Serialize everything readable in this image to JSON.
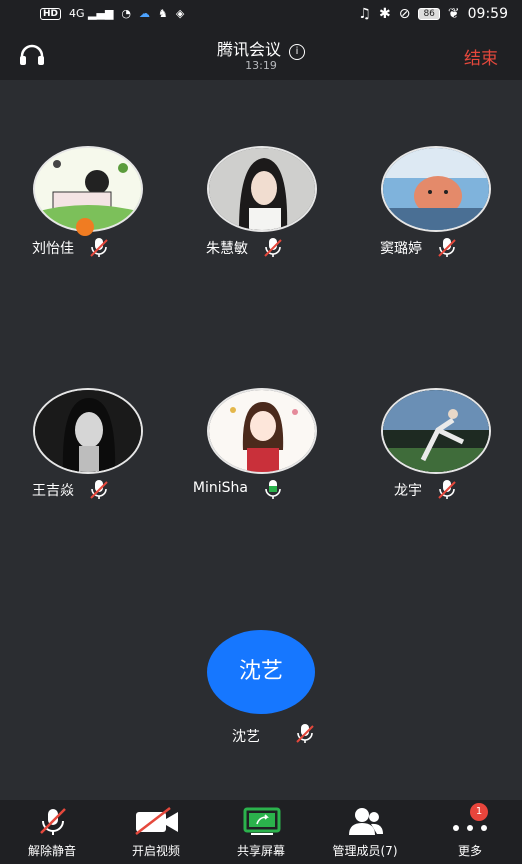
{
  "status_bar": {
    "network": "HD",
    "signal": "4G",
    "battery": "86",
    "time": "09:59"
  },
  "header": {
    "title": "腾讯会议",
    "time": "13:19",
    "end_label": "结束"
  },
  "participants": [
    {
      "name": "刘怡佳",
      "mic": "muted",
      "host": true
    },
    {
      "name": "朱慧敏",
      "mic": "muted"
    },
    {
      "name": "窦璐婷",
      "mic": "muted"
    },
    {
      "name": "王吉焱",
      "mic": "muted"
    },
    {
      "name": "MiniSha",
      "mic": "on"
    },
    {
      "name": "龙宇",
      "mic": "muted"
    }
  ],
  "self": {
    "avatar_text": "沈艺",
    "name": "沈艺",
    "mic": "muted"
  },
  "toolbar": {
    "unmute_label": "解除静音",
    "video_label": "开启视频",
    "share_label": "共享屏幕",
    "members_label": "管理成员(7)",
    "more_label": "更多",
    "more_badge": "1"
  },
  "colors": {
    "accent": "#1677ff",
    "end": "#e5483c",
    "share": "#2bb24c",
    "muted": "#e5483c"
  }
}
